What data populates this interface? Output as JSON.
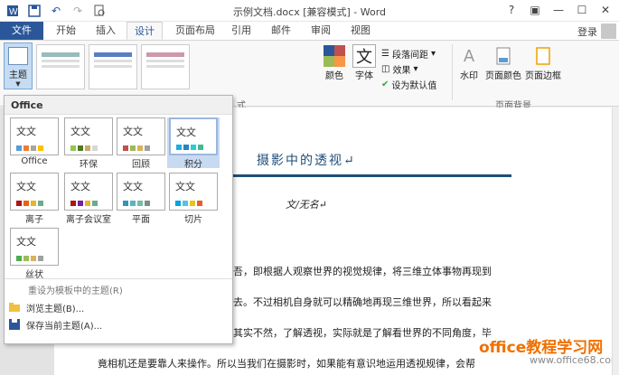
{
  "window": {
    "title": "示例文档.docx [兼容模式] - Word",
    "help": "?",
    "controls": [
      "restore-icon",
      "minimize-icon",
      "maximize-icon",
      "close-icon"
    ]
  },
  "qat": [
    "word-logo-icon",
    "save-icon",
    "undo-icon",
    "redo-icon",
    "print-preview-icon"
  ],
  "tabs": [
    "文件",
    "开始",
    "插入",
    "设计",
    "页面布局",
    "引用",
    "邮件",
    "审阅",
    "视图"
  ],
  "active_tab": "设计",
  "account": {
    "login": "登录"
  },
  "ribbon": {
    "theme_button": "主题",
    "colors": "颜色",
    "fonts": "字体",
    "paragraph_spacing": "段落间距",
    "effects": "效果",
    "set_default": "设为默认值",
    "watermark": "水印",
    "page_color": "页面颜色",
    "page_borders": "页面边框",
    "group_page_background": "页面背景",
    "group_partial": "式"
  },
  "dropdown": {
    "header": "Office",
    "themes": [
      {
        "name": "Office",
        "colors": [
          "#5b9bd5",
          "#ed7d31",
          "#a5a5a5",
          "#ffc000"
        ]
      },
      {
        "name": "环保",
        "colors": [
          "#96c350",
          "#507a1f",
          "#c8a96e",
          "#d7d7d7"
        ]
      },
      {
        "name": "回顾",
        "colors": [
          "#c0504d",
          "#9bbb59",
          "#d8b25c",
          "#a0a0a0"
        ]
      },
      {
        "name": "积分",
        "colors": [
          "#1cade4",
          "#2683c6",
          "#27ced7",
          "#42ba97"
        ]
      },
      {
        "name": "离子",
        "colors": [
          "#b01513",
          "#ea6312",
          "#e6b729",
          "#6aac90"
        ]
      },
      {
        "name": "离子会议室",
        "colors": [
          "#b01513",
          "#7a1fa2",
          "#e6b729",
          "#6aac90"
        ]
      },
      {
        "name": "平面",
        "colors": [
          "#3494ba",
          "#58b6c0",
          "#75bda7",
          "#7a8c8e"
        ]
      },
      {
        "name": "切片",
        "colors": [
          "#05a4de",
          "#4dc5e0",
          "#f0c01c",
          "#e95b30"
        ]
      },
      {
        "name": "丝状",
        "colors": [
          "#4cae4e",
          "#9bbb59",
          "#d8b25c",
          "#a0a0a0"
        ]
      }
    ],
    "thumb_text": "文文",
    "selected": "积分",
    "menu": [
      {
        "label": "重设为模板中的主题(R)",
        "icon": "",
        "disabled": true
      },
      {
        "label": "浏览主题(B)...",
        "icon": "folder-icon",
        "disabled": false
      },
      {
        "label": "保存当前主题(A)...",
        "icon": "save-theme-icon",
        "disabled": false
      }
    ]
  },
  "document": {
    "title": "摄影中的透视↵",
    "author": "文/无名↵",
    "lines": [
      "吾，即根据人观察世界的视觉规律，将三维立体事物再现到",
      "去。不过相机自身就可以精确地再现三维世界，所以看起来",
      "其实不然，了解透视，实际就是了解看世界的不同角度，毕",
      "竟相机还是要靠人来操作。所以当我们在摄影时，如果能有意识地运用透视规律，会帮"
    ]
  },
  "watermark": {
    "site": "office教程学习网",
    "url": "www.office68.com"
  }
}
